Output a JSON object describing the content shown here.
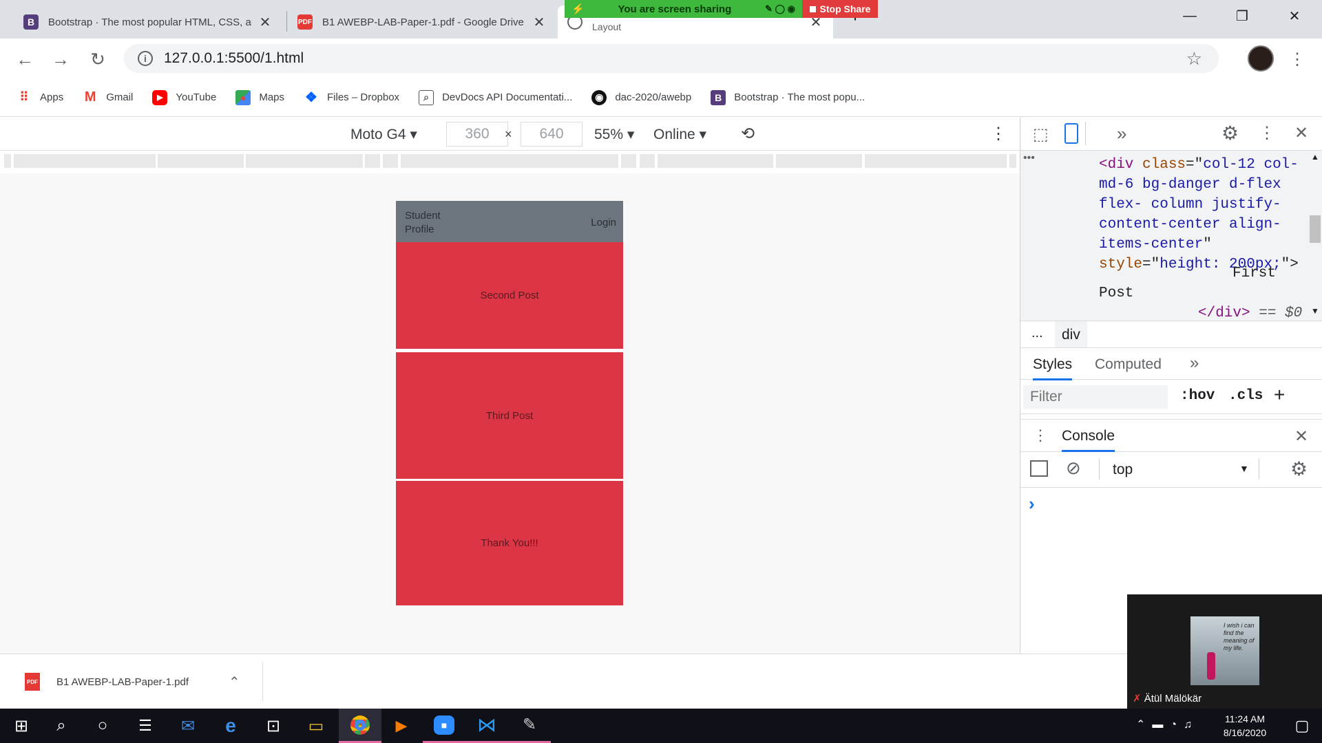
{
  "tabs": [
    {
      "title": "Bootstrap · The most popular HTML, CSS, and JS library",
      "fav": "B"
    },
    {
      "title": "B1 AWEBP-LAB-Paper-1.pdf - Google Drive",
      "fav": "PDF"
    },
    {
      "title": "Layout",
      "fav": ""
    }
  ],
  "screen_share": {
    "status": "You are screen sharing",
    "stop": "Stop Share"
  },
  "address": {
    "url": "127.0.0.1:5500/1.html"
  },
  "bookmarks": [
    {
      "label": "Apps"
    },
    {
      "label": "Gmail"
    },
    {
      "label": "YouTube"
    },
    {
      "label": "Maps"
    },
    {
      "label": "Files – Dropbox"
    },
    {
      "label": "DevDocs API Documentati..."
    },
    {
      "label": "dac-2020/awebp"
    },
    {
      "label": "Bootstrap · The most popu..."
    }
  ],
  "device_toolbar": {
    "device": "Moto G4",
    "width": "360",
    "height": "640",
    "times": "×",
    "zoom": "55%",
    "network": "Online"
  },
  "page": {
    "brand": "Student Profile",
    "login": "Login",
    "posts": [
      "Second Post",
      "Third Post",
      "Thank You!!!"
    ]
  },
  "devtools": {
    "code_lines": [
      {
        "t": "tag",
        "s": "<div "
      },
      {
        "t": "attr",
        "s": "class"
      },
      {
        "t": "plain",
        "s": "=\""
      },
      {
        "t": "val",
        "s": "col-12 col-md-6 bg-danger d-flex flex- column justify-content-center align-items-center"
      },
      {
        "t": "plain",
        "s": "\" "
      },
      {
        "t": "attr",
        "s": "style"
      },
      {
        "t": "plain",
        "s": "=\""
      },
      {
        "t": "val",
        "s": "height: 200px;"
      },
      {
        "t": "plain",
        "s": "\">"
      }
    ],
    "text_node": "First Post",
    "close_tag": "</div>",
    "eq": "== $0",
    "breadcrumb_dots": "...",
    "breadcrumb": "div",
    "tabs": [
      "Styles",
      "Computed"
    ],
    "filter_placeholder": "Filter",
    "hov": ":hov",
    "cls": ".cls",
    "plus": "+",
    "console_title": "Console",
    "context": "top",
    "prompt": "›"
  },
  "download": {
    "file": "B1 AWEBP-LAB-Paper-1.pdf",
    "icon_text": "PDF"
  },
  "zoom_popup": {
    "name": "Ätül Mälökär",
    "image_text": "I wish i can find the meaning of my life."
  },
  "clock": {
    "time": "11:24 AM",
    "date": "8/16/2020"
  },
  "colors": {
    "danger": "#dc3545",
    "navbar": "#6c757d",
    "accent": "#1a73e8"
  }
}
